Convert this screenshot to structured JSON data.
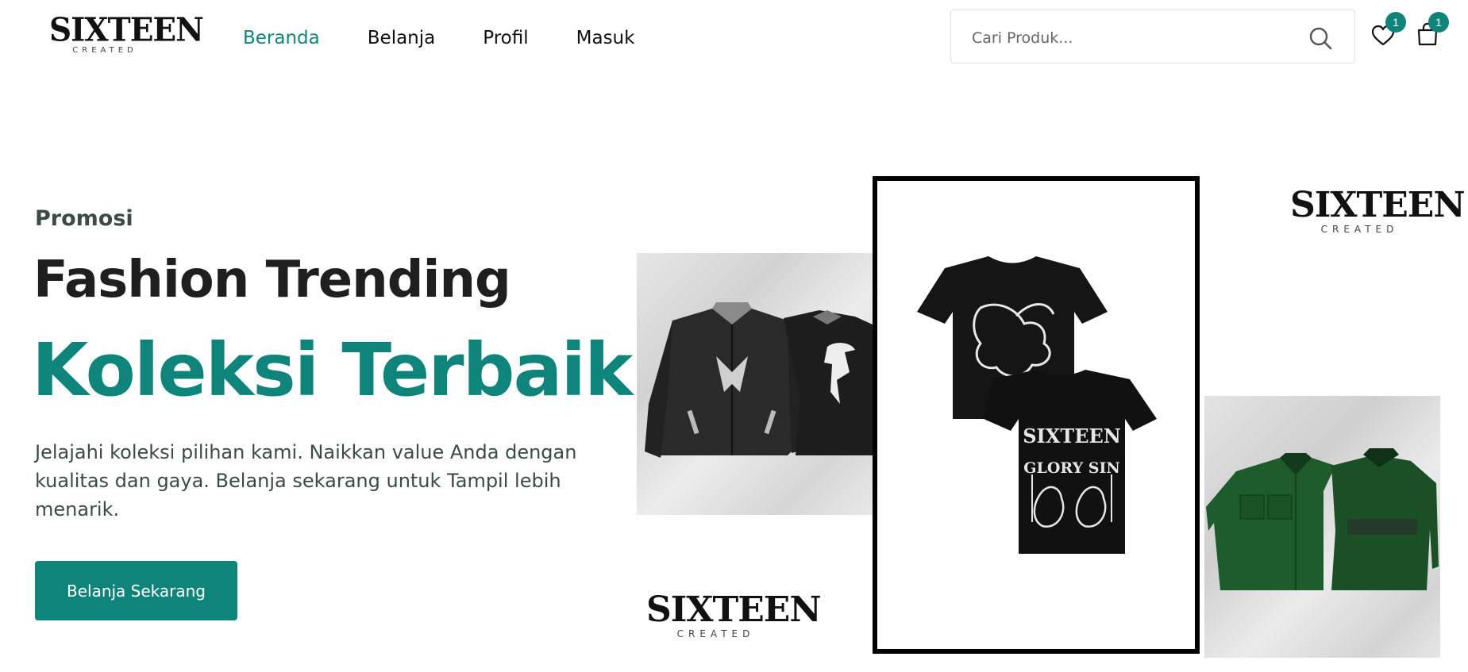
{
  "brand": {
    "name": "SIXTEEN",
    "subtitle": "CREATED"
  },
  "nav": [
    {
      "label": "Beranda",
      "active": true
    },
    {
      "label": "Belanja",
      "active": false
    },
    {
      "label": "Profil",
      "active": false
    },
    {
      "label": "Masuk",
      "active": false
    }
  ],
  "search": {
    "placeholder": "Cari Produk...",
    "value": "",
    "icon": "search-icon"
  },
  "wishlist": {
    "icon": "heart-icon",
    "count": "1"
  },
  "cart": {
    "icon": "shopping-bag-icon",
    "count": "1"
  },
  "hero": {
    "eyebrow": "Promosi",
    "title": "Fashion Trending",
    "highlight": "Koleksi Terbaik",
    "description": "Jelajahi koleksi pilihan kami. Naikkan value Anda dengan kualitas dan gaya. Belanja sekarang untuk Tampil lebih menarik.",
    "cta_label": "Belanja Sekarang"
  },
  "collage": {
    "tee_print_top": "SIXTEEN",
    "tee_print_bottom": "GLORY SIN"
  },
  "colors": {
    "accent": "#0f847a",
    "text": "#1f1f1f",
    "muted": "#3c4a45"
  }
}
